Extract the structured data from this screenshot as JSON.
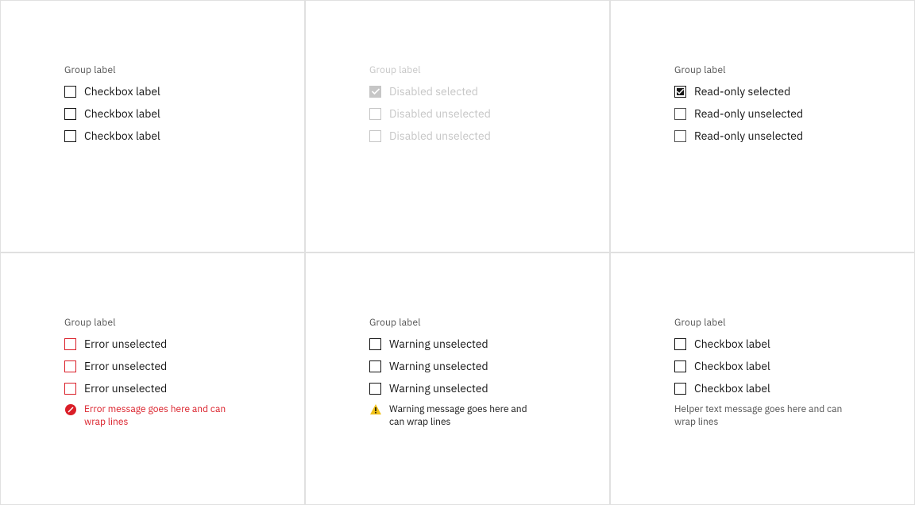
{
  "groups": [
    {
      "id": "default",
      "group_label": "Group label",
      "items": [
        {
          "label": "Checkbox label"
        },
        {
          "label": "Checkbox label"
        },
        {
          "label": "Checkbox label"
        }
      ]
    },
    {
      "id": "disabled",
      "group_label": "Group label",
      "items": [
        {
          "label": "Disabled selected"
        },
        {
          "label": "Disabled unselected"
        },
        {
          "label": "Disabled unselected"
        }
      ]
    },
    {
      "id": "readonly",
      "group_label": "Group label",
      "items": [
        {
          "label": "Read-only selected"
        },
        {
          "label": "Read-only unselected"
        },
        {
          "label": "Read-only unselected"
        }
      ]
    },
    {
      "id": "error",
      "group_label": "Group label",
      "items": [
        {
          "label": "Error unselected"
        },
        {
          "label": "Error unselected"
        },
        {
          "label": "Error unselected"
        }
      ],
      "message": "Error message goes here and can wrap lines"
    },
    {
      "id": "warning",
      "group_label": "Group label",
      "items": [
        {
          "label": "Warning unselected"
        },
        {
          "label": "Warning unselected"
        },
        {
          "label": "Warning unselected"
        }
      ],
      "message": "Warning message goes here and can wrap lines"
    },
    {
      "id": "helper",
      "group_label": "Group label",
      "items": [
        {
          "label": "Checkbox label"
        },
        {
          "label": "Checkbox label"
        },
        {
          "label": "Checkbox label"
        }
      ],
      "message": "Helper text message goes here and can wrap lines"
    }
  ],
  "colors": {
    "text": "#161616",
    "text_secondary": "#525252",
    "disabled": "#c6c6c6",
    "error": "#da1e28",
    "warning": "#f1c21b",
    "border": "#e0e0e0"
  }
}
